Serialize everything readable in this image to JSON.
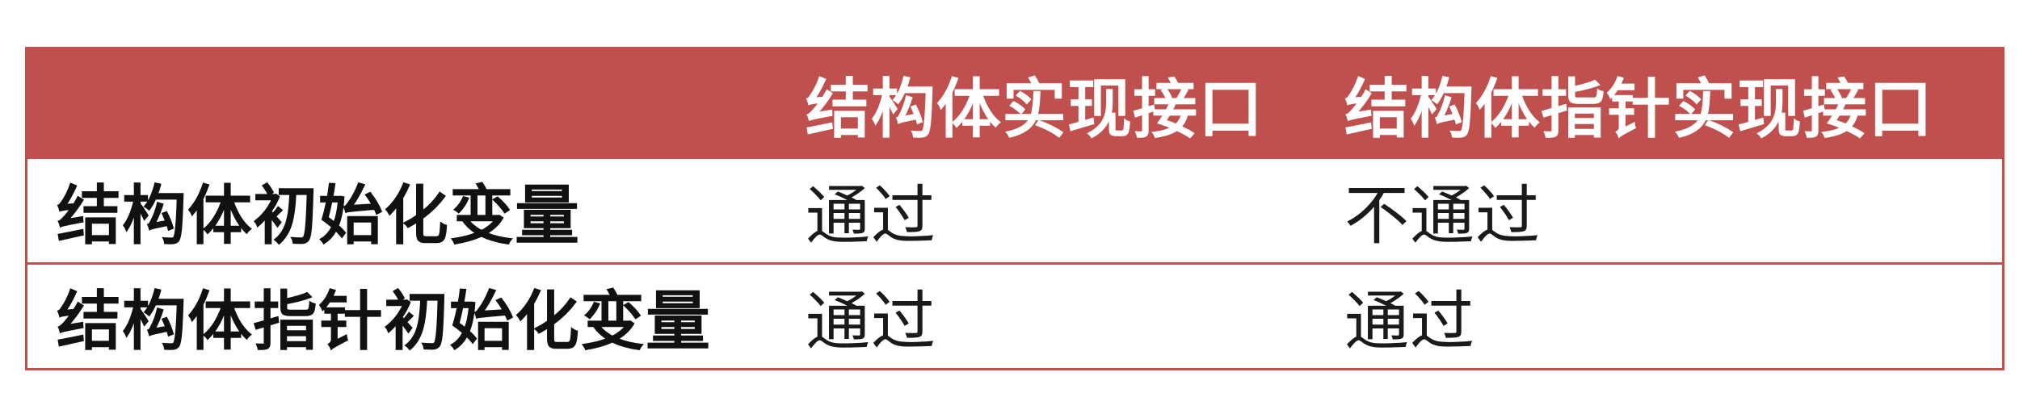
{
  "table": {
    "header": {
      "corner": "",
      "col1": "结构体实现接口",
      "col2": "结构体指针实现接口"
    },
    "rows": [
      {
        "label": "结构体初始化变量",
        "col1": "通过",
        "col2": "不通过"
      },
      {
        "label": "结构体指针初始化变量",
        "col1": "通过",
        "col2": "通过"
      }
    ]
  },
  "colors": {
    "accent": "#c0504d",
    "header_text": "#ffffff",
    "body_text": "#1a1a1a"
  }
}
